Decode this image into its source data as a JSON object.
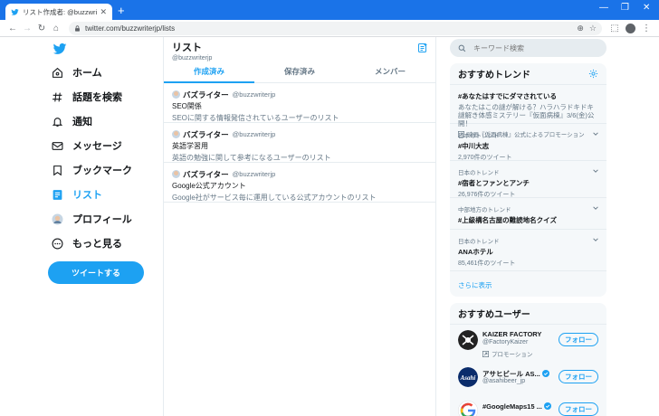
{
  "browser": {
    "tab_title": "リスト作成者: @buzzwriterjp / Twit",
    "tab_close": "✕",
    "new_tab": "+",
    "url": "twitter.com/buzzwriterjp/lists",
    "window_controls": [
      "—",
      "❐",
      "✕"
    ]
  },
  "nav": {
    "items": [
      {
        "label": "ホーム",
        "icon": "home-icon"
      },
      {
        "label": "話題を検索",
        "icon": "hashtag-icon"
      },
      {
        "label": "通知",
        "icon": "bell-icon"
      },
      {
        "label": "メッセージ",
        "icon": "mail-icon"
      },
      {
        "label": "ブックマーク",
        "icon": "bookmark-icon"
      },
      {
        "label": "リスト",
        "icon": "list-icon"
      },
      {
        "label": "プロフィール",
        "icon": "profile-avatar-icon"
      },
      {
        "label": "もっと見る",
        "icon": "more-icon"
      }
    ],
    "active_index": 5,
    "tweet_button": "ツイートする"
  },
  "center": {
    "title": "リスト",
    "handle": "@buzzwriterjp",
    "tabs": [
      "作成済み",
      "保存済み",
      "メンバー"
    ],
    "active_tab": 0,
    "lists": [
      {
        "owner": "バズライター",
        "handle": "@buzzwriterjp",
        "title": "SEO関係",
        "description": "SEOに関する情報発信されているユーザーのリスト"
      },
      {
        "owner": "バズライター",
        "handle": "@buzzwriterjp",
        "title": "英語学習用",
        "description": "英語の勉強に関して参考になるユーザーのリスト"
      },
      {
        "owner": "バズライター",
        "handle": "@buzzwriterjp",
        "title": "Google公式アカウント",
        "description": "Google社がサービス毎に運用している公式アカウントのリスト"
      }
    ]
  },
  "search": {
    "placeholder": "キーワード検索"
  },
  "trends": {
    "title": "おすすめトレンド",
    "promoted": {
      "tag": "#あなたはすでにダマされている",
      "text": "あなたはこの謎が解ける？ハラハラドキドキ謎解き体感ミステリー『仮面病棟』3/6(金)公開！",
      "by": "映画『仮面病棟』公式によるプロモーション"
    },
    "items": [
      {
        "context": "日本のトレンド",
        "name": "#中川大志",
        "count": "2,970件のツイート"
      },
      {
        "context": "日本のトレンド",
        "name": "#宿者とファンとアンチ",
        "count": "26,976件のツイート"
      },
      {
        "context": "中部地方のトレンド",
        "name": "#上級構名古屋の難読地名クイズ",
        "count": ""
      },
      {
        "context": "日本のトレンド",
        "name": "ANAホテル",
        "count": "85,461件のツイート"
      }
    ],
    "show_more": "さらに表示"
  },
  "who_to_follow": {
    "title": "おすすめユーザー",
    "users": [
      {
        "name": "KAIZER FACTORY",
        "handle": "@FactoryKaizer",
        "promoted": "プロモーション",
        "button": "フォロー",
        "verified": false
      },
      {
        "name": "アサヒビール AS...",
        "handle": "@asahibeer_jp",
        "promoted": "",
        "button": "フォロー",
        "verified": true
      },
      {
        "name": "#GoogleMaps15 ...",
        "handle": "",
        "promoted": "",
        "button": "フォロー",
        "verified": true
      }
    ]
  },
  "colors": {
    "accent": "#1da1f2",
    "chrome": "#1a73e8",
    "panel": "#f5f8fa",
    "border": "#e6ecf0",
    "muted": "#657786"
  }
}
